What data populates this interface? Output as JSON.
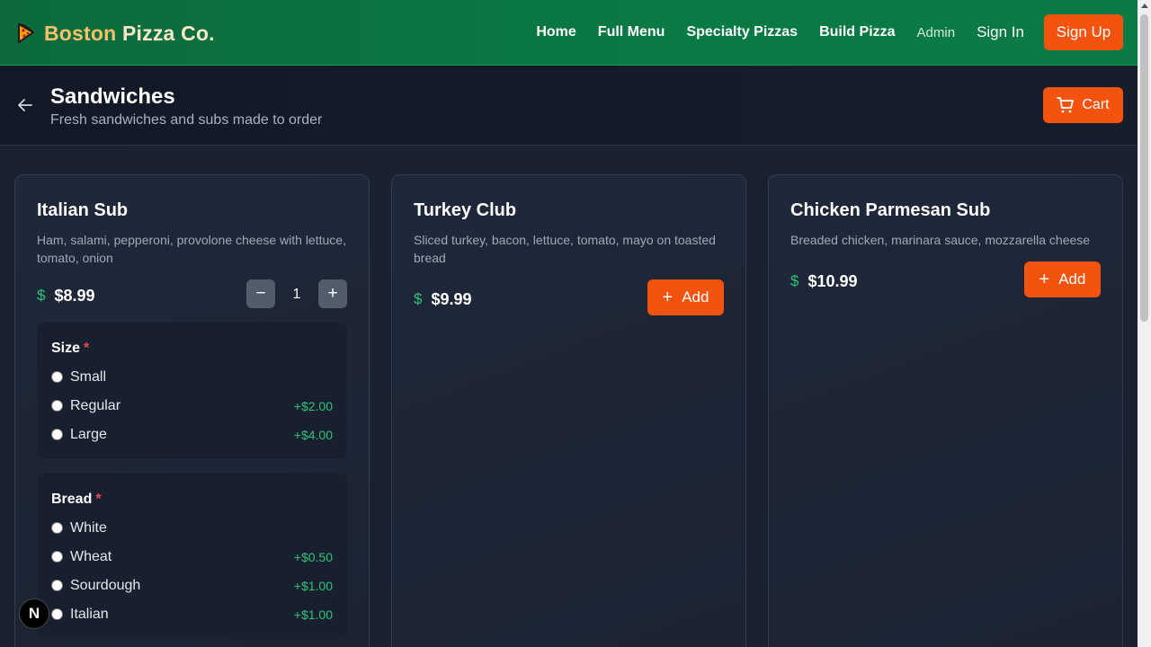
{
  "brand": {
    "word1": "Boston",
    "word2": "Pizza Co."
  },
  "nav": {
    "home": "Home",
    "full_menu": "Full Menu",
    "specialty": "Specialty Pizzas",
    "build": "Build Pizza",
    "admin": "Admin",
    "sign_in": "Sign In",
    "sign_up": "Sign Up"
  },
  "header": {
    "title": "Sandwiches",
    "subtitle": "Fresh sandwiches and subs made to order",
    "cart_label": "Cart"
  },
  "items": [
    {
      "name": "Italian Sub",
      "description": "Ham, salami, pepperoni, provolone cheese with lettuce, tomato, onion",
      "price": "$8.99",
      "quantity": "1",
      "minus": "−",
      "plus": "+",
      "option_groups": [
        {
          "title": "Size",
          "required": "*",
          "options": [
            {
              "label": "Small",
              "price": ""
            },
            {
              "label": "Regular",
              "price": "+$2.00"
            },
            {
              "label": "Large",
              "price": "+$4.00"
            }
          ]
        },
        {
          "title": "Bread",
          "required": "*",
          "options": [
            {
              "label": "White",
              "price": ""
            },
            {
              "label": "Wheat",
              "price": "+$0.50"
            },
            {
              "label": "Sourdough",
              "price": "+$1.00"
            },
            {
              "label": "Italian",
              "price": "+$1.00"
            }
          ]
        }
      ]
    },
    {
      "name": "Turkey Club",
      "description": "Sliced turkey, bacon, lettuce, tomato, mayo on toasted bread",
      "price": "$9.99",
      "add_label": "Add"
    },
    {
      "name": "Chicken Parmesan Sub",
      "description": "Breaded chicken, marinara sauce, mozzarella cheese",
      "price": "$10.99",
      "add_label": "Add"
    }
  ],
  "dollar_symbol": "$",
  "plus_symbol": "+",
  "next_badge": "N",
  "colors": {
    "accent": "#f4520f",
    "nav_green": "#0a7a44",
    "price_green": "#2fc27a",
    "required_red": "#f0455b"
  }
}
